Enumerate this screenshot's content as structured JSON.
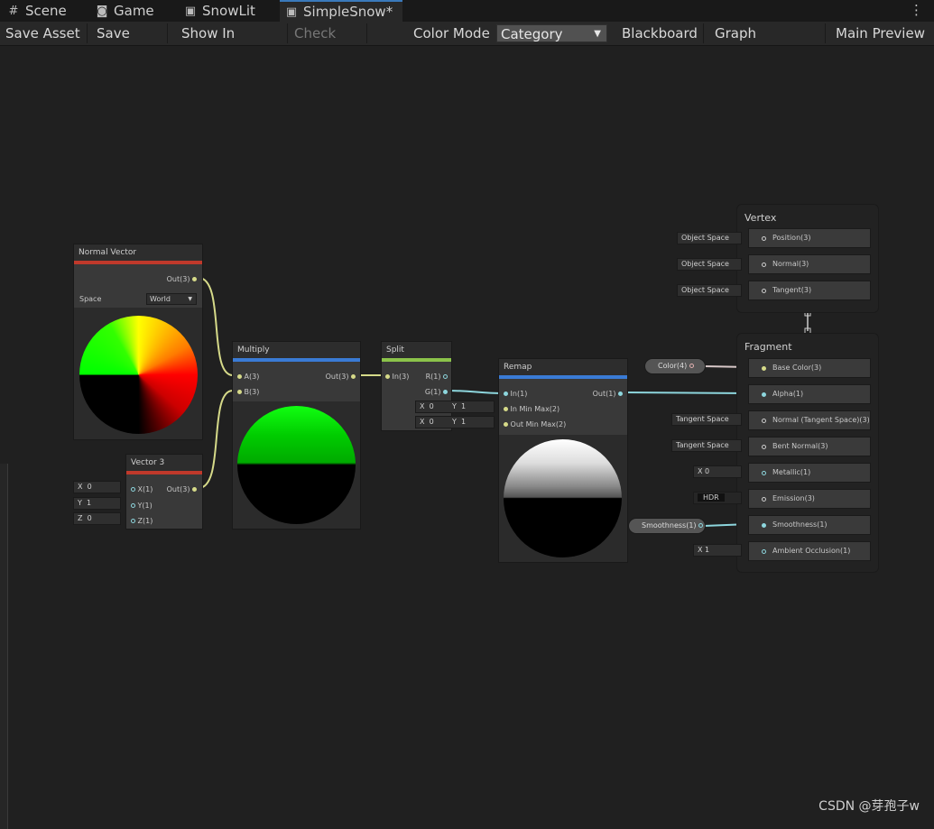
{
  "tabs": [
    {
      "label": "Scene",
      "icon": "grid-icon"
    },
    {
      "label": "Game",
      "icon": "gamepad-icon"
    },
    {
      "label": "SnowLit",
      "icon": "shader-icon"
    },
    {
      "label": "SimpleSnow*",
      "icon": "shader-icon",
      "active": true
    }
  ],
  "toolbar": {
    "save_asset": "Save Asset",
    "save_as": "Save As...",
    "show_in_project": "Show In Project",
    "check_out": "Check Out",
    "color_mode_label": "Color Mode",
    "color_mode_value": "Category",
    "blackboard": "Blackboard",
    "graph_inspector": "Graph Inspector",
    "main_preview": "Main Preview"
  },
  "nodes": {
    "normal_vector": {
      "title": "Normal Vector",
      "out": "Out(3)",
      "space_label": "Space",
      "space_value": "World",
      "accent": "#c0392b"
    },
    "vector3": {
      "title": "Vector 3",
      "out": "Out(3)",
      "inputs": [
        {
          "axis": "X",
          "value": "0",
          "port": "X(1)"
        },
        {
          "axis": "Y",
          "value": "1",
          "port": "Y(1)"
        },
        {
          "axis": "Z",
          "value": "0",
          "port": "Z(1)"
        }
      ],
      "accent": "#c0392b"
    },
    "multiply": {
      "title": "Multiply",
      "a": "A(3)",
      "b": "B(3)",
      "out": "Out(3)",
      "accent": "#3a7bd5"
    },
    "split": {
      "title": "Split",
      "in": "In(3)",
      "r": "R(1)",
      "g": "G(1)",
      "accent": "#8bc34a"
    },
    "remap": {
      "title": "Remap",
      "in": "In(1)",
      "in_min_max": "In Min Max(2)",
      "out_min_max": "Out Min Max(2)",
      "out": "Out(1)",
      "accent": "#3a7bd5",
      "in_x": "0",
      "in_y": "1",
      "out_x": "0",
      "out_y": "1"
    }
  },
  "vertex": {
    "title": "Vertex",
    "slots": [
      {
        "label": "Position(3)",
        "inline": "Object Space"
      },
      {
        "label": "Normal(3)",
        "inline": "Object Space"
      },
      {
        "label": "Tangent(3)",
        "inline": "Object Space"
      }
    ]
  },
  "fragment": {
    "title": "Fragment",
    "slots": [
      {
        "label": "Base Color(3)",
        "prop": "Color(4)"
      },
      {
        "label": "Alpha(1)"
      },
      {
        "label": "Normal (Tangent Space)(3)",
        "inline": "Tangent Space"
      },
      {
        "label": "Bent Normal(3)",
        "inline": "Tangent Space"
      },
      {
        "label": "Metallic(1)",
        "inline": "X  0"
      },
      {
        "label": "Emission(3)",
        "inline": "HDR"
      },
      {
        "label": "Smoothness(1)",
        "prop": "Smoothness(1)"
      },
      {
        "label": "Ambient Occlusion(1)",
        "inline": "X  1"
      }
    ]
  },
  "watermark": "CSDN @芽孢子w",
  "colors": {
    "wire_vector3": "#d6da89",
    "wire_float": "#8dd6dd",
    "wire_color": "#d8c8c8",
    "header_blue": "#3a7bd5",
    "header_red": "#c0392b",
    "header_green": "#8bc34a"
  }
}
